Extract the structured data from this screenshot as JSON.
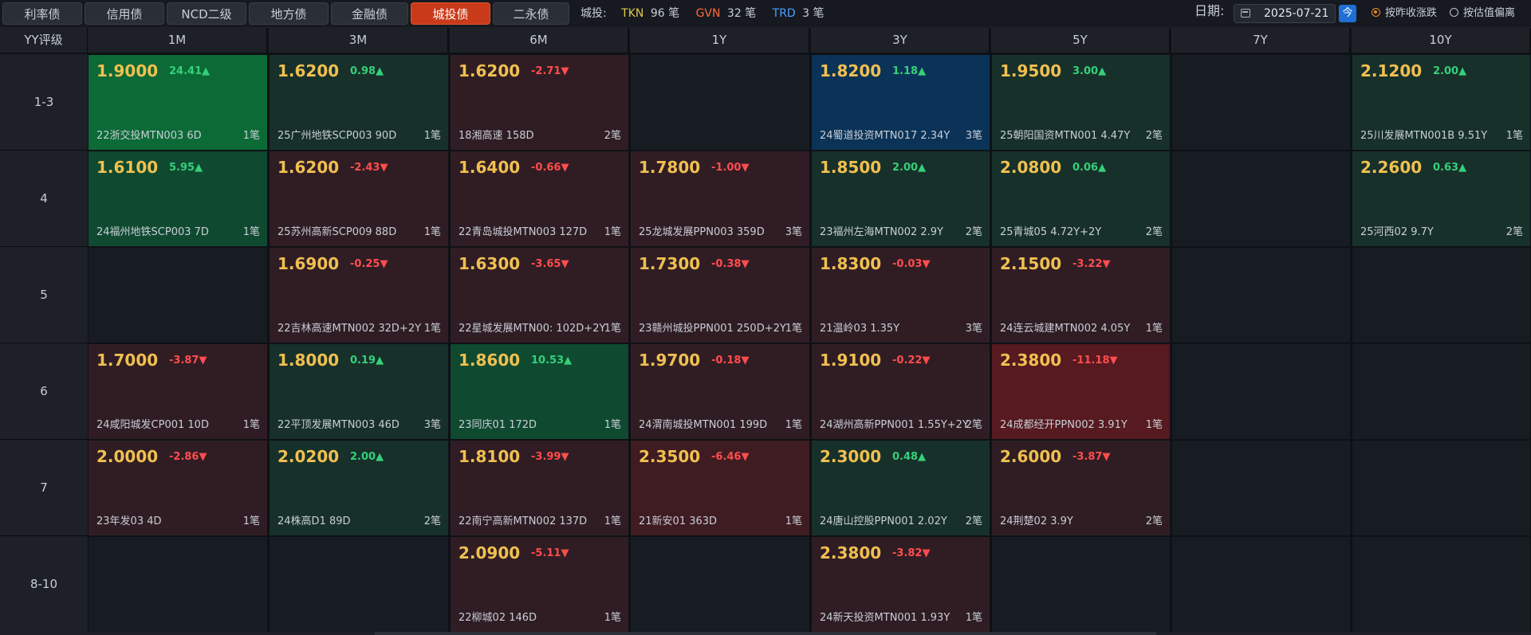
{
  "tabs": [
    {
      "label": "利率债",
      "active": false
    },
    {
      "label": "信用债",
      "active": false
    },
    {
      "label": "NCD二级",
      "active": false
    },
    {
      "label": "地方债",
      "active": false
    },
    {
      "label": "金融债",
      "active": false
    },
    {
      "label": "城投债",
      "active": true
    },
    {
      "label": "二永债",
      "active": false
    }
  ],
  "stats": {
    "label": "城投:",
    "tkn_label": "TKN",
    "tkn_value": "96 笔",
    "gvn_label": "GVN",
    "gvn_value": "32 笔",
    "trd_label": "TRD",
    "trd_value": "3 笔"
  },
  "date": {
    "label": "日期:",
    "value": "2025-07-21",
    "today_label": "今"
  },
  "radios": [
    {
      "label": "按昨收涨跌",
      "checked": true
    },
    {
      "label": "按估值偏离",
      "checked": false
    }
  ],
  "colors": {
    "up": "#35d07a",
    "down": "#ff4d4d",
    "price": "#f0c050",
    "active_tab": "#c93a1a"
  },
  "grid": {
    "corner": "YY评级",
    "columns": [
      "1M",
      "3M",
      "6M",
      "1Y",
      "3Y",
      "5Y",
      "7Y",
      "10Y"
    ],
    "rows": [
      {
        "label": "1-3",
        "cells": [
          {
            "price": "1.9000",
            "change": "24.41▲",
            "dir": "up",
            "tone": "strong",
            "bond": "22浙交投MTN003 6D",
            "count": "1笔"
          },
          {
            "price": "1.6200",
            "change": "0.98▲",
            "dir": "up",
            "bond": "25广州地铁SCP003 90D",
            "count": "1笔"
          },
          {
            "price": "1.6200",
            "change": "-2.71▼",
            "dir": "down",
            "bond": "18湘高速 158D",
            "count": "2笔"
          },
          null,
          {
            "price": "1.8200",
            "change": "1.18▲",
            "dir": "up",
            "tone": "blue",
            "bond": "24蜀道投资MTN017 2.34Y",
            "count": "3笔"
          },
          {
            "price": "1.9500",
            "change": "3.00▲",
            "dir": "up",
            "bond": "25朝阳国资MTN001 4.47Y",
            "count": "2笔"
          },
          null,
          {
            "price": "2.1200",
            "change": "2.00▲",
            "dir": "up",
            "bond": "25川发展MTN001B 9.51Y",
            "count": "1笔"
          }
        ]
      },
      {
        "label": "4",
        "cells": [
          {
            "price": "1.6100",
            "change": "5.95▲",
            "dir": "up",
            "tone": "mid",
            "bond": "24福州地铁SCP003 7D",
            "count": "1笔"
          },
          {
            "price": "1.6200",
            "change": "-2.43▼",
            "dir": "down",
            "bond": "25苏州高新SCP009 88D",
            "count": "1笔"
          },
          {
            "price": "1.6400",
            "change": "-0.66▼",
            "dir": "down",
            "bond": "22青岛城投MTN003 127D",
            "count": "1笔"
          },
          {
            "price": "1.7800",
            "change": "-1.00▼",
            "dir": "down",
            "bond": "25龙城发展PPN003 359D",
            "count": "3笔"
          },
          {
            "price": "1.8500",
            "change": "2.00▲",
            "dir": "up",
            "bond": "23福州左海MTN002 2.9Y",
            "count": "2笔"
          },
          {
            "price": "2.0800",
            "change": "0.06▲",
            "dir": "up",
            "bond": "25青城05 4.72Y+2Y",
            "count": "2笔"
          },
          null,
          {
            "price": "2.2600",
            "change": "0.63▲",
            "dir": "up",
            "bond": "25河西02 9.7Y",
            "count": "2笔"
          }
        ]
      },
      {
        "label": "5",
        "cells": [
          null,
          {
            "price": "1.6900",
            "change": "-0.25▼",
            "dir": "down",
            "bond": "22吉林高速MTN002 32D+2Y",
            "count": "1笔"
          },
          {
            "price": "1.6300",
            "change": "-3.65▼",
            "dir": "down",
            "bond": "22星城发展MTN00: 102D+2Y",
            "count": "1笔"
          },
          {
            "price": "1.7300",
            "change": "-0.38▼",
            "dir": "down",
            "bond": "23赣州城投PPN001 250D+2Y",
            "count": "1笔"
          },
          {
            "price": "1.8300",
            "change": "-0.03▼",
            "dir": "down",
            "bond": "21温岭03 1.35Y",
            "count": "3笔"
          },
          {
            "price": "2.1500",
            "change": "-3.22▼",
            "dir": "down",
            "bond": "24连云城建MTN002 4.05Y",
            "count": "1笔"
          },
          null,
          null
        ]
      },
      {
        "label": "6",
        "cells": [
          {
            "price": "1.7000",
            "change": "-3.87▼",
            "dir": "down",
            "bond": "24咸阳城发CP001 10D",
            "count": "1笔"
          },
          {
            "price": "1.8000",
            "change": "0.19▲",
            "dir": "up",
            "bond": "22平顶发展MTN003 46D",
            "count": "3笔"
          },
          {
            "price": "1.8600",
            "change": "10.53▲",
            "dir": "up",
            "tone": "mid",
            "bond": "23同庆01 172D",
            "count": "1笔"
          },
          {
            "price": "1.9700",
            "change": "-0.18▼",
            "dir": "down",
            "bond": "24渭南城投MTN001 199D",
            "count": "1笔"
          },
          {
            "price": "1.9100",
            "change": "-0.22▼",
            "dir": "down",
            "bond": "24湖州高新PPN001 1.55Y+2Y",
            "count": "2笔"
          },
          {
            "price": "2.3800",
            "change": "-11.18▼",
            "dir": "down",
            "tone": "strong",
            "bond": "24成都经开PPN002 3.91Y",
            "count": "1笔"
          },
          null,
          null
        ]
      },
      {
        "label": "7",
        "cells": [
          {
            "price": "2.0000",
            "change": "-2.86▼",
            "dir": "down",
            "bond": "23年发03 4D",
            "count": "1笔"
          },
          {
            "price": "2.0200",
            "change": "2.00▲",
            "dir": "up",
            "bond": "24株高D1 89D",
            "count": "2笔"
          },
          {
            "price": "1.8100",
            "change": "-3.99▼",
            "dir": "down",
            "bond": "22南宁高新MTN002 137D",
            "count": "1笔"
          },
          {
            "price": "2.3500",
            "change": "-6.46▼",
            "dir": "down",
            "tone": "mid",
            "bond": "21新安01 363D",
            "count": "1笔"
          },
          {
            "price": "2.3000",
            "change": "0.48▲",
            "dir": "up",
            "bond": "24唐山控股PPN001 2.02Y",
            "count": "2笔"
          },
          {
            "price": "2.6000",
            "change": "-3.87▼",
            "dir": "down",
            "bond": "24荆楚02 3.9Y",
            "count": "2笔"
          },
          null,
          null
        ]
      },
      {
        "label": "8-10",
        "cells": [
          null,
          null,
          {
            "price": "2.0900",
            "change": "-5.11▼",
            "dir": "down",
            "bond": "22柳城02 146D",
            "count": "1笔"
          },
          null,
          {
            "price": "2.3800",
            "change": "-3.82▼",
            "dir": "down",
            "bond": "24新天投资MTN001 1.93Y",
            "count": "1笔"
          },
          null,
          null,
          null
        ]
      }
    ]
  }
}
